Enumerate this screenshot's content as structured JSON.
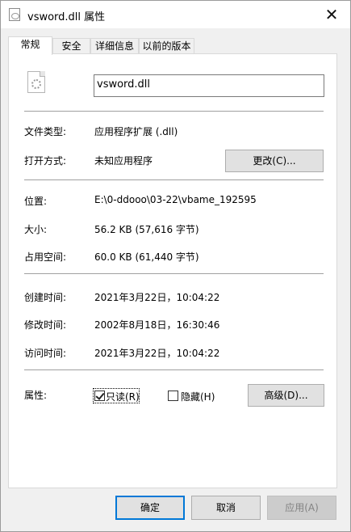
{
  "window": {
    "title": "vsword.dll 属性",
    "close_glyph": "✕"
  },
  "tabs": [
    {
      "label": "常规",
      "active": true
    },
    {
      "label": "安全",
      "active": false
    },
    {
      "label": "详细信息",
      "active": false
    },
    {
      "label": "以前的版本",
      "active": false
    }
  ],
  "file": {
    "name": "vsword.dll",
    "icon": "dll-file-icon"
  },
  "details": {
    "type_label": "文件类型:",
    "type_value": "应用程序扩展 (.dll)",
    "open_with_label": "打开方式:",
    "open_with_value": "未知应用程序",
    "change_button": "更改(C)...",
    "location_label": "位置:",
    "location_value": "E:\\0-ddooo\\03-22\\vbame_192595",
    "size_label": "大小:",
    "size_value": "56.2 KB (57,616 字节)",
    "disk_size_label": "占用空间:",
    "disk_size_value": "60.0 KB (61,440 字节)",
    "created_label": "创建时间:",
    "created_value": "2021年3月22日，10:04:22",
    "modified_label": "修改时间:",
    "modified_value": "2002年8月18日，16:30:46",
    "accessed_label": "访问时间:",
    "accessed_value": "2021年3月22日，10:04:22"
  },
  "attributes": {
    "label": "属性:",
    "readonly_label": "只读(R)",
    "readonly_checked": true,
    "hidden_label": "隐藏(H)",
    "hidden_checked": false,
    "advanced_button": "高级(D)..."
  },
  "footer": {
    "ok": "确定",
    "cancel": "取消",
    "apply": "应用(A)"
  }
}
